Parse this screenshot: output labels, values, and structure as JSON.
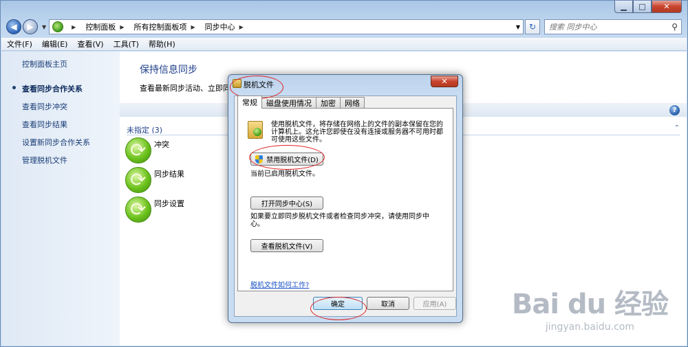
{
  "window": {
    "caption": {
      "min": "▁",
      "max": "□",
      "close": "✕"
    }
  },
  "address": {
    "breadcrumbs": [
      "控制面板",
      "所有控制面板项",
      "同步中心"
    ],
    "search_placeholder": "搜索 同步中心"
  },
  "menubar": {
    "items": [
      "文件(F)",
      "编辑(E)",
      "查看(V)",
      "工具(T)",
      "帮助(H)"
    ]
  },
  "sidebar": {
    "items": [
      {
        "label": "控制面板主页"
      },
      {
        "label": "查看同步合作关系"
      },
      {
        "label": "查看同步冲突"
      },
      {
        "label": "查看同步结果"
      },
      {
        "label": "设置新同步合作关系"
      },
      {
        "label": "管理脱机文件"
      }
    ]
  },
  "main": {
    "title": "保持信息同步",
    "description": "查看最新同步活动、立即同步",
    "group_header": "未指定 (3)",
    "items": [
      {
        "label": "冲突"
      },
      {
        "label": "同步结果"
      },
      {
        "label": "同步设置"
      }
    ]
  },
  "dialog": {
    "title": "脱机文件",
    "tabs": [
      "常规",
      "磁盘使用情况",
      "加密",
      "网络"
    ],
    "description": "使用脱机文件，将存储在网络上的文件的副本保留在您的计算机上。这允许您即使在没有连接或服务器不可用时都可使用这些文件。",
    "disable_button": "禁用脱机文件(D)",
    "status_text": "当前已启用脱机文件。",
    "open_sync_button": "打开同步中心(S)",
    "sync_hint": "如果要立即同步脱机文件或者检查同步冲突，请使用同步中心。",
    "view_button": "查看脱机文件(V)",
    "help_link": "脱机文件如何工作?",
    "ok": "确定",
    "cancel": "取消",
    "apply": "应用(A)"
  },
  "watermark": {
    "top": "Bai du 经验",
    "bottom": "jingyan.baidu.com"
  }
}
